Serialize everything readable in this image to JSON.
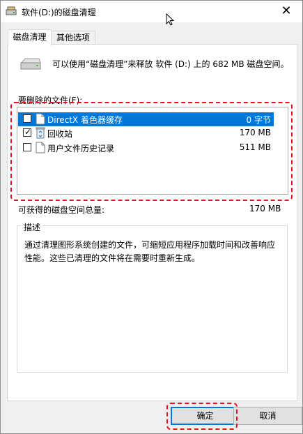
{
  "window": {
    "title": "软件(D:)的磁盘清理",
    "close_glyph": "✕"
  },
  "tabs": [
    {
      "label": "磁盘清理",
      "active": true
    },
    {
      "label": "其他选项",
      "active": false
    }
  ],
  "summary": {
    "text": "可以使用“磁盘清理”来释放 软件 (D:) 上的 682 MB 磁盘空间。"
  },
  "files_section": {
    "label": "要删除的文件(F):",
    "items": [
      {
        "name": "DirectX 着色器缓存",
        "size": "0 字节",
        "checked": false,
        "selected": true,
        "icon": "file-icon"
      },
      {
        "name": "回收站",
        "size": "170 MB",
        "checked": true,
        "selected": false,
        "icon": "recycle-bin-icon"
      },
      {
        "name": "用户文件历史记录",
        "size": "511 MB",
        "checked": false,
        "selected": false,
        "icon": "file-icon"
      }
    ]
  },
  "total": {
    "label": "可获得的磁盘空间总量:",
    "value": "170 MB"
  },
  "description": {
    "title": "描述",
    "text": "通过清理图形系统创建的文件，可缩短应用程序加载时间和改善响应性能。这些已清理的文件将在需要时重新生成。"
  },
  "buttons": {
    "ok": "确定",
    "cancel": "取消"
  },
  "colors": {
    "selection": "#0078d7",
    "highlight_annotation": "#e81123"
  }
}
